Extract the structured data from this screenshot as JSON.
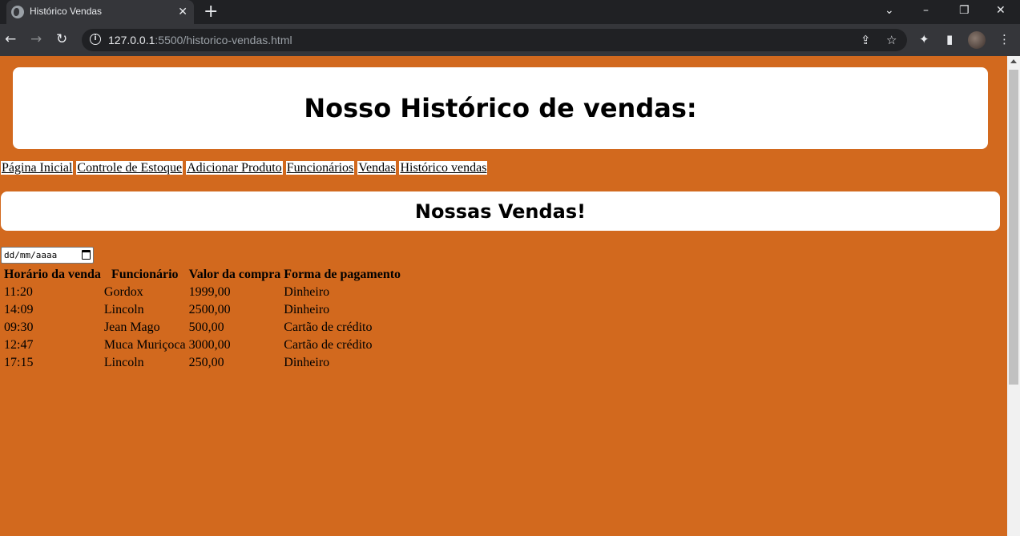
{
  "browser": {
    "tab_title": "Histórico Vendas",
    "tab_close": "✕",
    "new_tab": "+",
    "url_host": "127.0.0.1",
    "url_rest": ":5500/historico-vendas.html",
    "icons": {
      "back": "←",
      "forward": "→",
      "reload": "↻",
      "share": "⇪",
      "star": "☆",
      "extensions": "✦",
      "sidebar": "▮",
      "menu": "⋮",
      "chevron": "⌄",
      "minimize": "–",
      "restore": "❐",
      "close": "✕"
    }
  },
  "header": {
    "title": "Nosso Histórico de vendas:"
  },
  "nav": [
    "Página Inicial",
    "Controle de Estoque",
    "Adicionar Produto",
    "Funcionários",
    "Vendas",
    "Histórico vendas"
  ],
  "section": {
    "title": "Nossas Vendas!"
  },
  "date_filter": {
    "placeholder": "dd/mm/aaaa"
  },
  "table": {
    "headers": [
      "Horário da venda",
      "Funcionário",
      "Valor da compra",
      "Forma de pagamento"
    ],
    "rows": [
      [
        "11:20",
        "Gordox",
        "1999,00",
        "Dinheiro"
      ],
      [
        "14:09",
        "Lincoln",
        "2500,00",
        "Dinheiro"
      ],
      [
        "09:30",
        "Jean Mago",
        "500,00",
        "Cartão de crédito"
      ],
      [
        "12:47",
        "Muca Muriçoca",
        "3000,00",
        "Cartão de crédito"
      ],
      [
        "17:15",
        "Lincoln",
        "250,00",
        "Dinheiro"
      ]
    ]
  },
  "colors": {
    "page_background": "#d2691e",
    "panel": "#ffffff"
  }
}
